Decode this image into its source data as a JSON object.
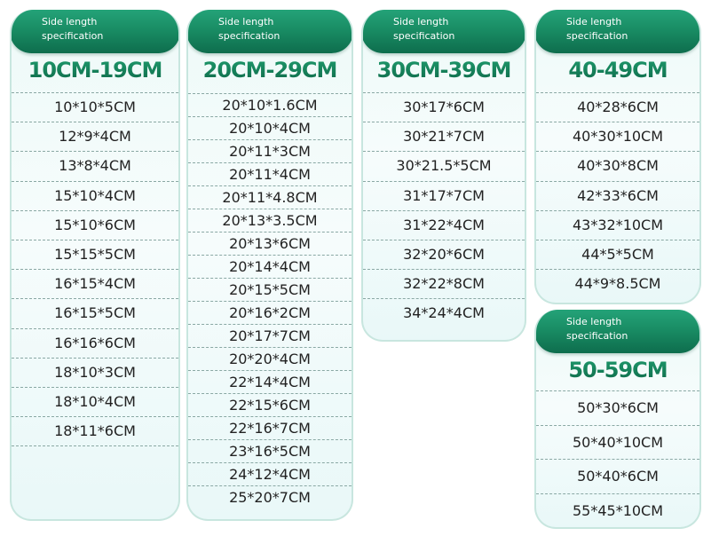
{
  "header_label": "Side length\nspecification",
  "header_line1": "Side length",
  "header_line2": "specification",
  "colors": {
    "header_green_top": "#24a378",
    "header_green_bottom": "#0e6d4d",
    "title_green": "#137a55",
    "card_border": "#c8e6df",
    "card_bg": "#eefaf8",
    "row_text": "#222222"
  },
  "cards": [
    {
      "header_line1": "Side length",
      "header_line2": "specification",
      "range": "10CM-19CM",
      "sizes": [
        "10*10*5CM",
        "12*9*4CM",
        "13*8*4CM",
        "15*10*4CM",
        "15*10*6CM",
        "15*15*5CM",
        "16*15*4CM",
        "16*15*5CM",
        "16*16*6CM",
        "18*10*3CM",
        "18*10*4CM",
        "18*11*6CM"
      ]
    },
    {
      "header_line1": "Side length",
      "header_line2": "specification",
      "range": "20CM-29CM",
      "sizes": [
        "20*10*1.6CM",
        "20*10*4CM",
        "20*11*3CM",
        "20*11*4CM",
        "20*11*4.8CM",
        "20*13*3.5CM",
        "20*13*6CM",
        "20*14*4CM",
        "20*15*5CM",
        "20*16*2CM",
        "20*17*7CM",
        "20*20*4CM",
        "22*14*4CM",
        "22*15*6CM",
        "22*16*7CM",
        "23*16*5CM",
        "24*12*4CM",
        "25*20*7CM"
      ]
    },
    {
      "header_line1": "Side length",
      "header_line2": "specification",
      "range": "30CM-39CM",
      "sizes": [
        "30*17*6CM",
        "30*21*7CM",
        "30*21.5*5CM",
        "31*17*7CM",
        "31*22*4CM",
        "32*20*6CM",
        "32*22*8CM",
        "34*24*4CM"
      ]
    },
    {
      "header_line1": "Side length",
      "header_line2": "specification",
      "range": "40-49CM",
      "sizes": [
        "40*28*6CM",
        "40*30*10CM",
        "40*30*8CM",
        "42*33*6CM",
        "43*32*10CM",
        "44*5*5CM",
        "44*9*8.5CM"
      ]
    },
    {
      "header_line1": "Side length",
      "header_line2": "specification",
      "range": "50-59CM",
      "sizes": [
        "50*30*6CM",
        "50*40*10CM",
        "50*40*6CM",
        "55*45*10CM"
      ]
    }
  ]
}
